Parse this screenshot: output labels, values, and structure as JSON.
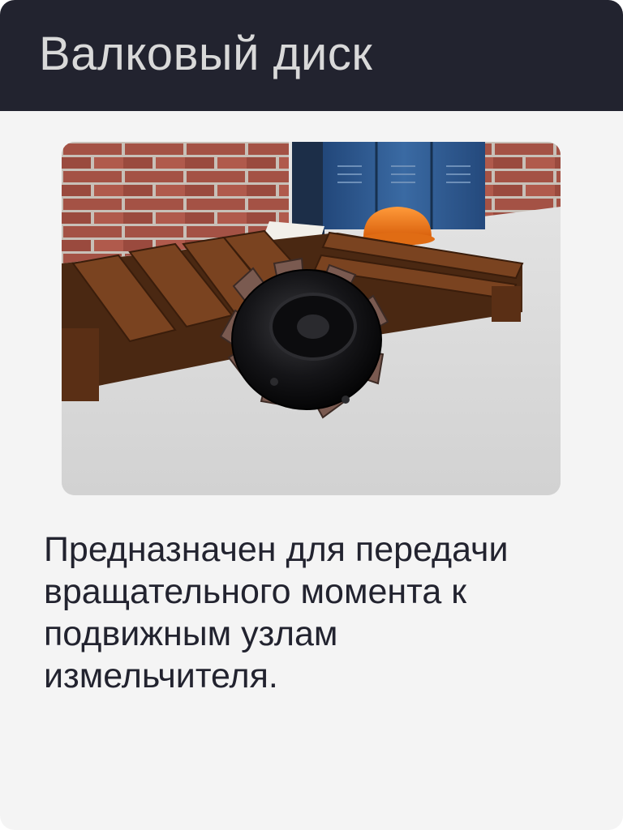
{
  "title": "Валковый диск",
  "scene": {
    "image_name": "roller-disc-3d-scene",
    "objects": [
      "brick-wall",
      "metal-lockers",
      "hard-hat",
      "wooden-pallet",
      "book",
      "roller-disc"
    ],
    "colors": {
      "header_bg": "#22232f",
      "card_bg": "#f4f4f4",
      "text": "#22232f",
      "title_text": "#d9d9d9",
      "hard_hat": "#f07a1a",
      "lockers": "#2e5a8f",
      "pallet": "#6b3a1e",
      "disc": "#1a1a1c",
      "disc_teeth": "#7a5a50"
    }
  },
  "description": "Предназначен для передачи вращательного момента к подвижным узлам измельчителя."
}
